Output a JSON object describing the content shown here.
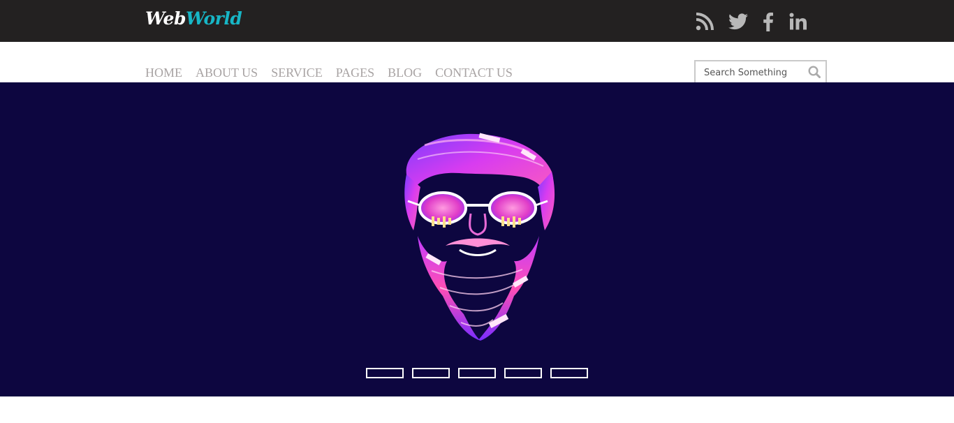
{
  "header": {
    "logo": {
      "part1": "Web",
      "part2": "World",
      "color1": "#ffffff",
      "color2": "#17b6c6"
    },
    "background": "#232121",
    "social": [
      "rss-icon",
      "twitter-icon",
      "facebook-icon",
      "linkedin-icon"
    ],
    "icon_color": "#b8b8b8"
  },
  "nav": {
    "items": [
      "HOME",
      "ABOUT US",
      "SERVICE",
      "PAGES",
      "BLOG",
      "CONTACT US"
    ],
    "color": "#a8a3a3"
  },
  "search": {
    "placeholder": "Search Something",
    "icon": "search-icon"
  },
  "hero": {
    "background": "#0d0640",
    "image": "neon bearded face with glasses illustration",
    "slides": 5
  }
}
